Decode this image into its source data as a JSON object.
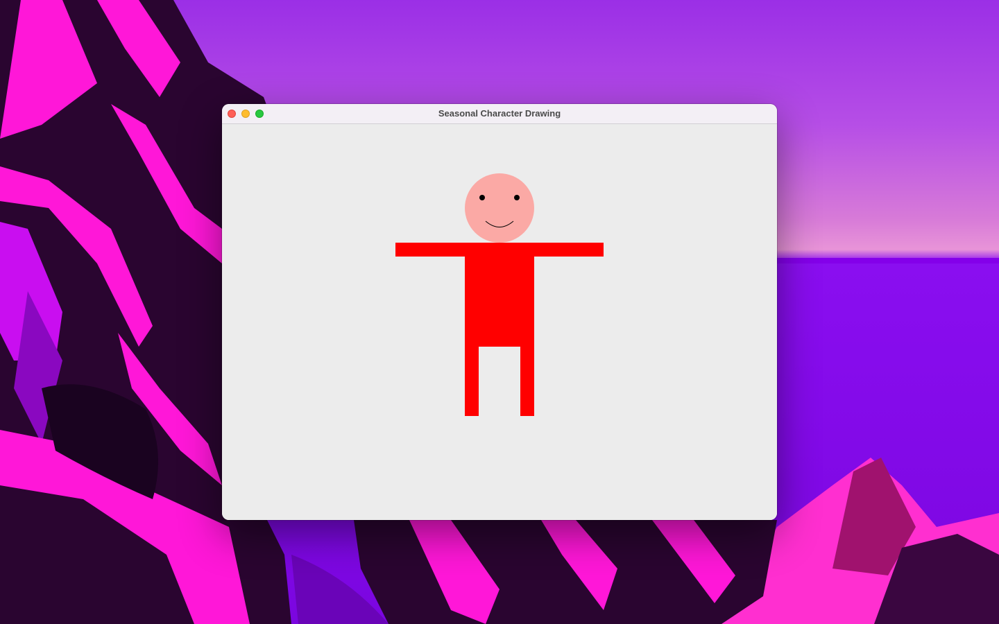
{
  "window": {
    "title": "Seasonal Character Drawing"
  },
  "colors": {
    "canvas_background": "#ececec",
    "shirt": "#ff0000",
    "skin": "#fba9a5",
    "eyes": "#000000",
    "smile": "#000000"
  },
  "icons": {
    "close": "close-icon",
    "minimize": "minimize-icon",
    "zoom": "zoom-icon"
  }
}
